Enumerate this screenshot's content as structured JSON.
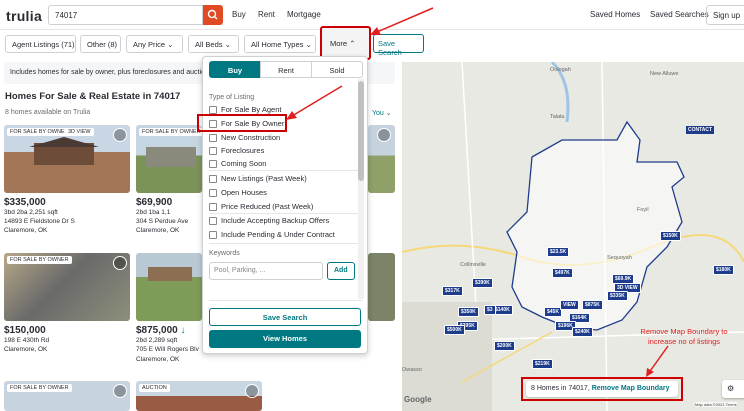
{
  "header": {
    "logo": "trulia",
    "search_value": "74017",
    "nav": [
      "Buy",
      "Rent",
      "Mortgage"
    ],
    "right_nav": [
      "Saved Homes",
      "Saved Searches"
    ],
    "signup": "Sign up"
  },
  "filters": {
    "agent_listings": "Agent Listings (71)",
    "other": "Other (8)",
    "any_price": "Any Price",
    "all_beds": "All Beds",
    "all_home_types": "All Home Types",
    "more": "More",
    "save_search": "Save Search"
  },
  "info_bar": "Includes homes for sale by owner, plus foreclosures and auction",
  "results": {
    "title": "Homes For Sale & Real Estate in 74017",
    "count": "8 homes available on Trulia",
    "sort": "You"
  },
  "cards": [
    {
      "badge": "FOR SALE BY OWNER",
      "badge2": "3D VIEW",
      "price": "$335,000",
      "specs": "3bd  2ba  2,251 sqft",
      "address": "14893 E Fieldstone Dr S",
      "city": "Claremore, OK"
    },
    {
      "badge": "FOR SALE BY OWNER",
      "price": "$69,900",
      "specs": "2bd  1ba  1,1",
      "address": "304 S Perdue Ave",
      "city": "Claremore, OK"
    },
    {
      "badge": "FOR SALE BY OWNER",
      "price": "$150,000",
      "specs": "",
      "address": "198 E 430th Rd",
      "city": "Claremore, OK"
    },
    {
      "badge": "",
      "price": "$875,000",
      "specs": "2bd  2,289 sqft",
      "address": "705 E Will Rogers Blv",
      "city": "Claremore, OK"
    },
    {
      "badge": "FOR SALE BY OWNER",
      "price": "",
      "specs": "",
      "address": "",
      "city": ""
    },
    {
      "badge": "AUCTION",
      "price": "",
      "specs": "",
      "address": "",
      "city": ""
    }
  ],
  "dropdown": {
    "tabs": [
      "Buy",
      "Rent",
      "Sold"
    ],
    "type_label": "Type of Listing",
    "options": [
      "For Sale By Agent",
      "For Sale By Owner",
      "New Construction",
      "Foreclosures",
      "Coming Soon",
      "New Listings (Past Week)",
      "Open Houses",
      "Price Reduced (Past Week)",
      "Include Accepting Backup Offers",
      "Include Pending & Under Contract"
    ],
    "keywords_label": "Keywords",
    "keywords_placeholder": "Pool, Parking, ...",
    "add": "Add",
    "save_search": "Save Search",
    "view_homes": "View Homes"
  },
  "map": {
    "labels": [
      "Oologah",
      "New Alluwe",
      "Talala",
      "Foyil",
      "Collinsville",
      "Sequoyah",
      "Owasso"
    ],
    "price_tags": [
      "$23.5K",
      "$497K",
      "$317K",
      "$390K",
      "$150K",
      "$69.9K",
      "3D VIEW",
      "$335K",
      "$350K",
      "$140K",
      "$3",
      "$45K",
      "VIEW",
      "$875K",
      "$164K",
      "$196K",
      "$240K",
      "$395K",
      "$500K",
      "$200K",
      "$219K",
      "$180K"
    ],
    "contact": "CONTACT",
    "annotation": "Remove Map Boundary to increase no of listings",
    "bottom_text": "8 Homes in 74017,",
    "bottom_link": "Remove Map Boundary",
    "google": "Google",
    "credit": "Map data ©2021  Terms"
  },
  "colors": {
    "brand": "#e14b24",
    "teal": "#007882",
    "pin": "#1e3c8c",
    "annotation": "#e02020"
  }
}
